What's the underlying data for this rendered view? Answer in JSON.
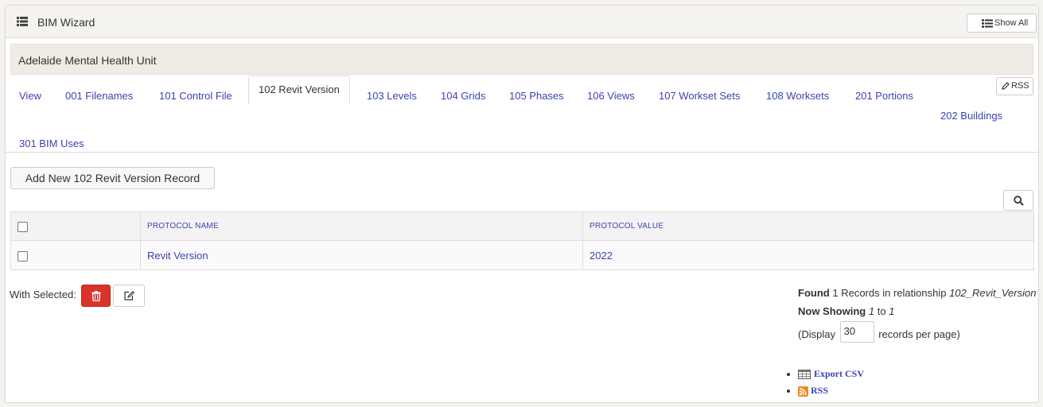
{
  "header": {
    "title": "BIM Wizard",
    "show_all_label": "Show All"
  },
  "record": {
    "title": "Adelaide Mental Health Unit"
  },
  "tabs": [
    "View",
    "001 Filenames",
    "101 Control File",
    "102 Revit Version",
    "103 Levels",
    "104 Grids",
    "105 Phases",
    "106 Views",
    "107 Workset Sets",
    "108 Worksets",
    "201 Portions",
    "202 Buildings",
    "301 BIM Uses"
  ],
  "active_tab": "102 Revit Version",
  "rss_button_label": "RSS",
  "add_button_label": "Add New 102 Revit Version Record",
  "table": {
    "columns": [
      "PROTOCOL NAME",
      "PROTOCOL VALUE"
    ],
    "rows": [
      {
        "protocol_name": "Revit Version",
        "protocol_value": "2022"
      }
    ]
  },
  "with_selected_label": "With Selected:",
  "status": {
    "found_label": "Found",
    "found_count": "1",
    "found_text": "Records in relationship",
    "relationship": "102_Revit_Version",
    "showing_label": "Now Showing",
    "showing_from": "1",
    "showing_to_word": "to",
    "showing_to": "1",
    "display_prefix": "(Display",
    "per_page": "30",
    "display_suffix": "records per page)"
  },
  "exports": {
    "csv_label": "Export CSV",
    "rss_label": "RSS"
  },
  "colors": {
    "link": "#3a43b5",
    "danger": "#d9342b",
    "panel_bg": "#f5f3ef"
  }
}
